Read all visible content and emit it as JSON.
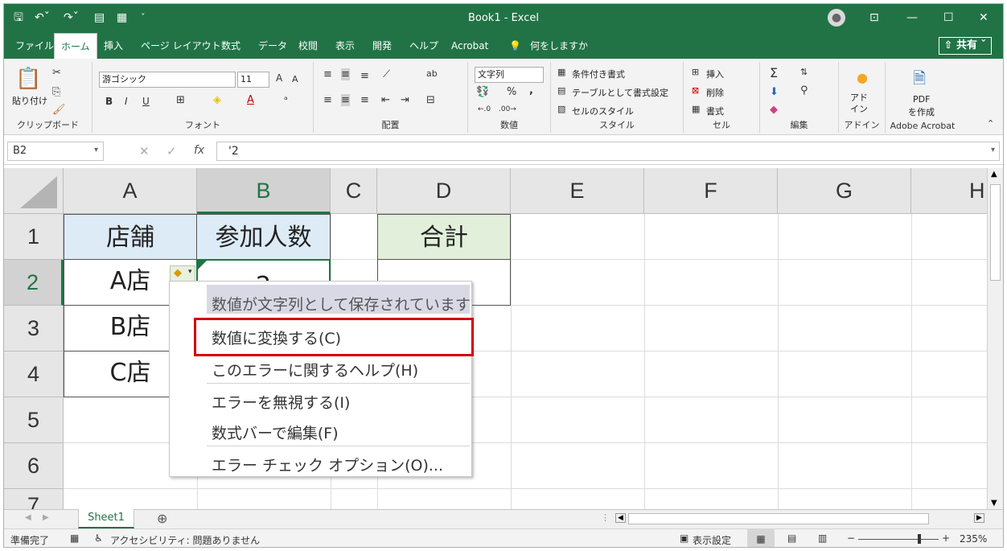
{
  "titlebar": {
    "title": "Book1  -  Excel",
    "qat": [
      "save-icon",
      "undo-icon",
      "redo-icon",
      "preview-icon",
      "form-icon"
    ],
    "controls": {
      "ribbon_display": "⊡",
      "minimize": "—",
      "maximize": "☐",
      "close": "✕"
    }
  },
  "menu": {
    "tabs": [
      "ファイル",
      "ホーム",
      "挿入",
      "ページ レイアウト",
      "数式",
      "データ",
      "校閲",
      "表示",
      "開発",
      "ヘルプ",
      "Acrobat"
    ],
    "tell_me": "何をしますか",
    "share": "共有"
  },
  "ribbon": {
    "clipboard": {
      "paste": "貼り付け",
      "label": "クリップボード"
    },
    "font": {
      "name": "游ゴシック",
      "size": "11",
      "bold": "B",
      "italic": "I",
      "underline": "U",
      "color_a": "A",
      "grow": "A",
      "shrink": "A",
      "label": "フォント"
    },
    "alignment": {
      "label": "配置"
    },
    "number": {
      "format": "文字列",
      "percent": "%",
      "comma": ",",
      "label": "数値"
    },
    "styles": {
      "conditional": "条件付き書式",
      "table": "テーブルとして書式設定",
      "cell_styles": "セルのスタイル",
      "label": "スタイル"
    },
    "cells": {
      "insert": "挿入",
      "delete": "削除",
      "format": "書式",
      "label": "セル"
    },
    "editing": {
      "sum": "Σ",
      "label": "編集"
    },
    "addins": {
      "btn": "アド\nイン",
      "label": "アドイン"
    },
    "acrobat": {
      "btn_line1": "PDF",
      "btn_line2": "を作成",
      "label": "Adobe Acrobat"
    }
  },
  "formula": {
    "name_box": "B2",
    "cancel": "✕",
    "enter": "✓",
    "fx": "fx",
    "value": "'2"
  },
  "grid": {
    "columns": [
      "A",
      "B",
      "C",
      "D",
      "E",
      "F",
      "G",
      "H"
    ],
    "rows": [
      "1",
      "2",
      "3",
      "4",
      "5",
      "6",
      "7"
    ],
    "cells": {
      "A1": "店舗",
      "B1": "参加人数",
      "D1": "合計",
      "A2": "A店",
      "B2": "2",
      "A3": "B店",
      "A4": "C店"
    }
  },
  "context_menu": {
    "header": "数値が文字列として保存されています",
    "items": [
      "数値に変換する(C)",
      "このエラーに関するヘルプ(H)",
      "エラーを無視する(I)",
      "数式バーで編集(F)",
      "エラー チェック オプション(O)..."
    ]
  },
  "sheets": {
    "tabs": [
      "Sheet1"
    ],
    "add": "⊕"
  },
  "status": {
    "ready": "準備完了",
    "accessibility": "アクセシビリティ: 問題ありません",
    "display_settings": "表示設定",
    "zoom": "235%",
    "zoom_minus": "−",
    "zoom_plus": "+"
  },
  "colors": {
    "excel_green": "#217346",
    "highlight_box": "#d40000",
    "header_fill": "#ddebf7",
    "total_fill": "#e2efda"
  }
}
